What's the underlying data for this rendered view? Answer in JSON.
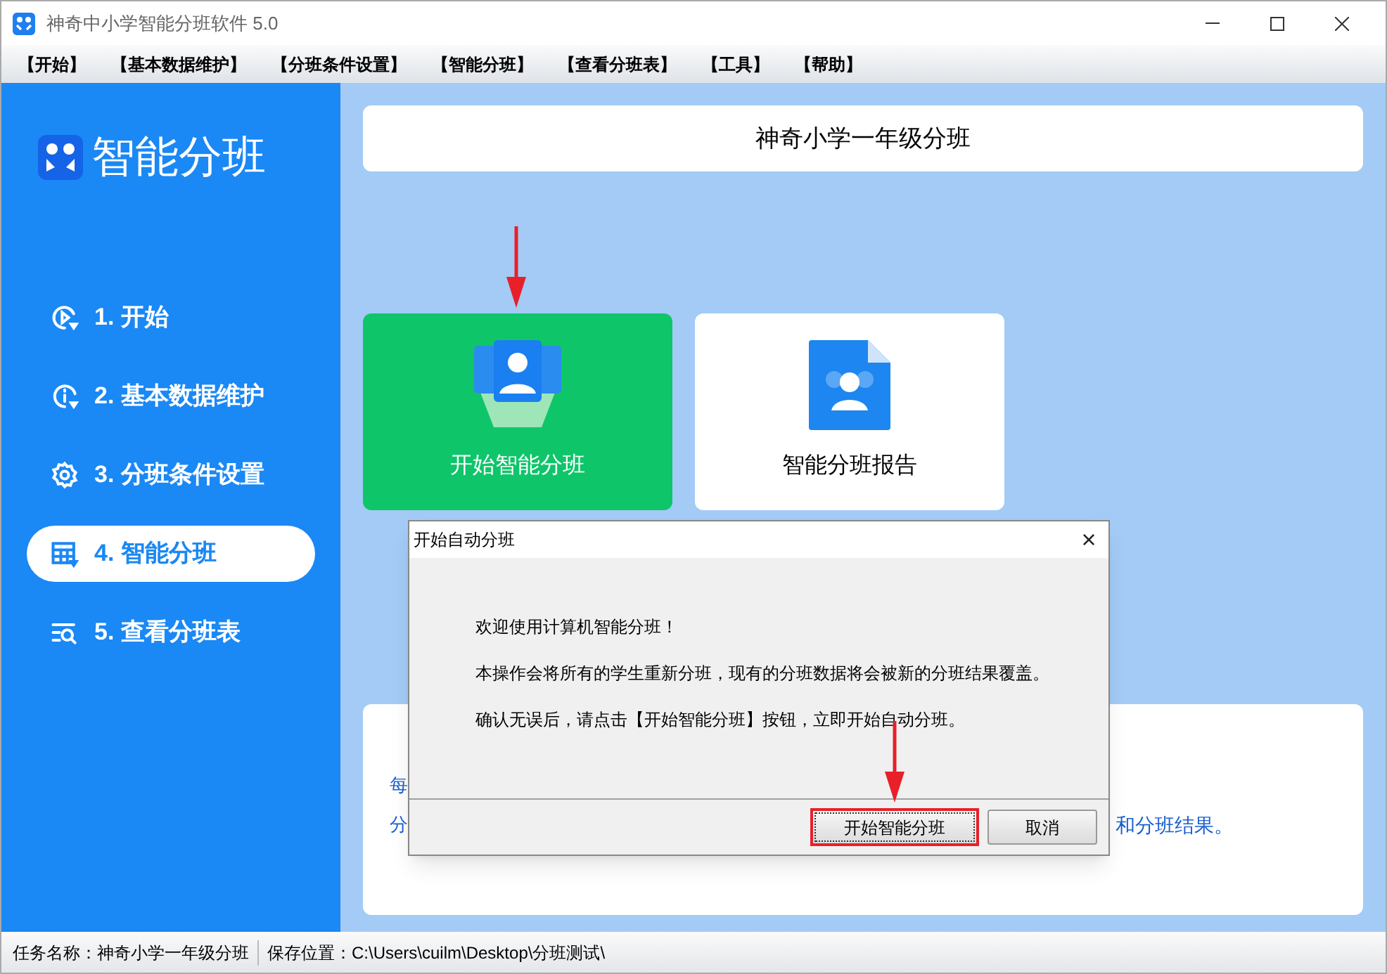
{
  "window": {
    "title": "神奇中小学智能分班软件 5.0"
  },
  "menu": [
    "【开始】",
    "【基本数据维护】",
    "【分班条件设置】",
    "【智能分班】",
    "【查看分班表】",
    "【工具】",
    "【帮助】"
  ],
  "sidebar": {
    "title": "智能分班",
    "items": [
      {
        "label": "1. 开始",
        "selected": false
      },
      {
        "label": "2. 基本数据维护",
        "selected": false
      },
      {
        "label": "3. 分班条件设置",
        "selected": false
      },
      {
        "label": "4. 智能分班",
        "selected": true
      },
      {
        "label": "5. 查看分班表",
        "selected": false
      }
    ]
  },
  "header": {
    "title": "神奇小学一年级分班"
  },
  "tiles": [
    {
      "label": "开始智能分班",
      "kind": "start",
      "pointed": true
    },
    {
      "label": "智能分班报告",
      "kind": "report",
      "pointed": false
    }
  ],
  "tips_card": {
    "line_1_fragment": "每",
    "line_2_start": "分",
    "line_2_end": "和分班结果。"
  },
  "dialog": {
    "title": "开始自动分班",
    "close": "×",
    "lines": [
      "欢迎使用计算机智能分班！",
      "本操作会将所有的学生重新分班，现有的分班数据将会被新的分班结果覆盖。",
      "确认无误后，请点击【开始智能分班】按钮，立即开始自动分班。"
    ],
    "buttons": [
      {
        "label": "开始智能分班",
        "highlighted": true,
        "pointed": true
      },
      {
        "label": "取消",
        "highlighted": false,
        "pointed": false
      }
    ]
  },
  "status_bar": {
    "task": "任务名称：神奇小学一年级分班",
    "location": "保存位置：C:\\Users\\cuilm\\Desktop\\分班测试\\"
  }
}
